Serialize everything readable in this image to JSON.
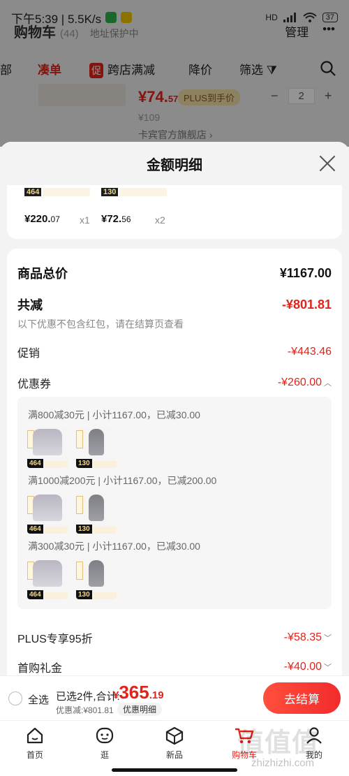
{
  "status": {
    "time_speed": "下午5:39 | 5.5K/s",
    "signal": "HD",
    "battery": "37"
  },
  "header": {
    "title": "购物车",
    "count": "(44)",
    "address": "地址保护中",
    "manage": "管理",
    "more": "•••"
  },
  "tabs": {
    "t0": "部",
    "t1": "凑单",
    "promo_badge": "促",
    "t2": "跨店满减",
    "t3": "降价",
    "t4": "筛选"
  },
  "bg_item": {
    "price_int": "¥74.",
    "price_dec": "57",
    "plus": "PLUS到手价",
    "qty": "2",
    "orig": "¥109",
    "shop": "卡宾官方旗舰店 ›"
  },
  "sheet": {
    "title": "金额明细"
  },
  "top_items": [
    {
      "tag": "464",
      "price": "¥220.",
      "price_dec": "07",
      "qty": "x1"
    },
    {
      "tag": "130",
      "price": "¥72.",
      "price_dec": "56",
      "qty": "x2"
    }
  ],
  "detail": {
    "goods_total_label": "商品总价",
    "goods_total_value": "¥1167.00",
    "discount_label": "共减",
    "discount_value": "-¥801.81",
    "discount_note": "以下优惠不包含红包，请在结算页查看",
    "promo_label": "促销",
    "promo_value": "-¥443.46",
    "coupon_label": "优惠券",
    "coupon_value": "-¥260.00",
    "plus_label": "PLUS专享95折",
    "plus_value": "-¥58.35",
    "first_label": "首购礼金",
    "first_value": "-¥40.00"
  },
  "coupons": [
    {
      "rule": "满800减30元 | 小计1167.00，已减30.00",
      "thumbs": [
        "464",
        "130"
      ]
    },
    {
      "rule": "满1000减200元 | 小计1167.00，已减200.00",
      "thumbs": [
        "464",
        "130"
      ]
    },
    {
      "rule": "满300减30元 | 小计1167.00，已减30.00",
      "thumbs": [
        "464",
        "130"
      ]
    }
  ],
  "checkout": {
    "select_all": "全选",
    "selected": "已选2件,合计:",
    "yen": "¥",
    "total_int": "365",
    "total_dec": ".19",
    "saved": "优惠减:¥801.81",
    "detail_link": "优惠明细",
    "pay": "去结算"
  },
  "nav": {
    "home": "首页",
    "browse": "逛",
    "new": "新品",
    "cart": "购物车",
    "mine": "我的"
  },
  "watermark": {
    "logo": "值值值",
    "url": "zhizhizhi.com"
  },
  "colors": {
    "accent_red": "#e2231a",
    "plus_gold": "#f1dfa5"
  }
}
